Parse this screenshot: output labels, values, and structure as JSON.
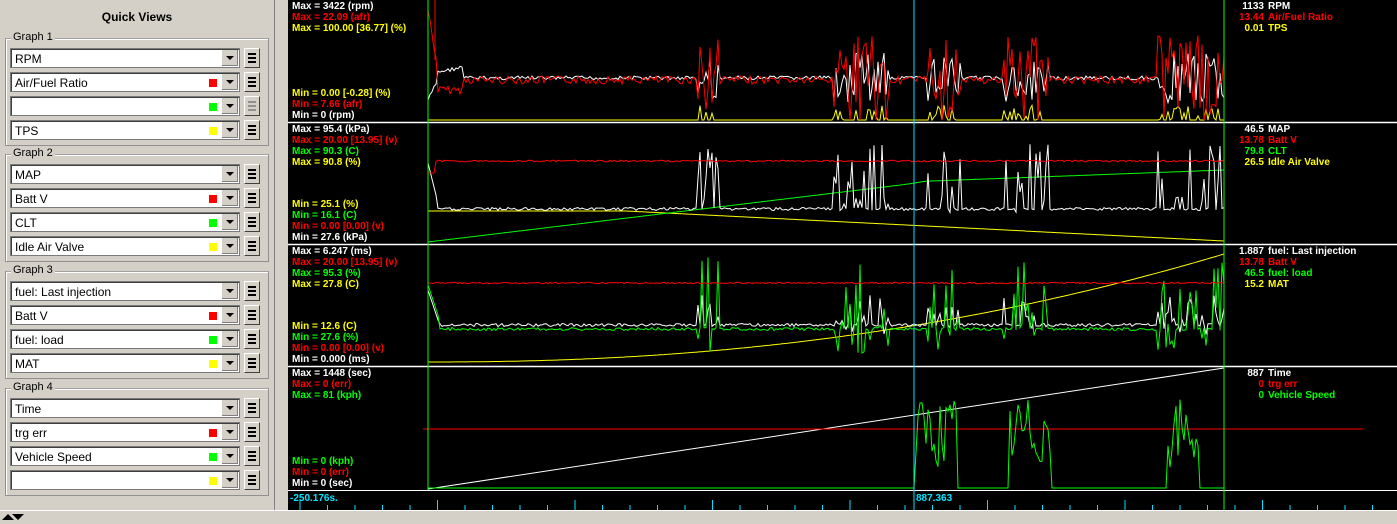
{
  "panel": {
    "title": "Quick Views",
    "groups": [
      {
        "label": "Graph 1",
        "fields": [
          {
            "name": "RPM",
            "color": ""
          },
          {
            "name": "Air/Fuel Ratio",
            "color": "#ff0000"
          },
          {
            "name": "",
            "color": "#00ff00"
          },
          {
            "name": "TPS",
            "color": "#ffff00"
          }
        ]
      },
      {
        "label": "Graph 2",
        "fields": [
          {
            "name": "MAP",
            "color": ""
          },
          {
            "name": "Batt V",
            "color": "#ff0000"
          },
          {
            "name": "CLT",
            "color": "#00ff00"
          },
          {
            "name": "Idle Air Valve",
            "color": "#ffff00"
          }
        ]
      },
      {
        "label": "Graph 3",
        "fields": [
          {
            "name": "fuel: Last injection",
            "color": ""
          },
          {
            "name": "Batt V",
            "color": "#ff0000"
          },
          {
            "name": "fuel: load",
            "color": "#00ff00"
          },
          {
            "name": "MAT",
            "color": "#ffff00"
          }
        ]
      },
      {
        "label": "Graph 4",
        "fields": [
          {
            "name": "Time",
            "color": ""
          },
          {
            "name": "trg err",
            "color": "#ff0000"
          },
          {
            "name": "Vehicle Speed",
            "color": "#00ff00"
          },
          {
            "name": "",
            "color": "#ffff00"
          }
        ]
      }
    ]
  },
  "graphs": [
    {
      "max_labels": [
        {
          "text": "Max = 3422 (rpm)",
          "color": "#ffffff"
        },
        {
          "text": "Max = 22.09 (afr)",
          "color": "#ff0000"
        },
        {
          "text": "Max = 100.00 [36.77] (%)",
          "color": "#ffff00"
        }
      ],
      "min_labels": [
        {
          "text": "Min = 0.00 [-0.28] (%)",
          "color": "#ffff00"
        },
        {
          "text": "Min = 7.66 (afr)",
          "color": "#ff0000"
        },
        {
          "text": "Min = 0 (rpm)",
          "color": "#ffffff"
        }
      ],
      "cursor_values": [
        {
          "value": "1133",
          "name": "RPM",
          "color": "#ffffff"
        },
        {
          "value": "13.44",
          "name": "Air/Fuel Ratio",
          "color": "#ff0000"
        },
        {
          "value": "0.01",
          "name": "TPS",
          "color": "#ffff00"
        }
      ]
    },
    {
      "max_labels": [
        {
          "text": "Max = 95.4 (kPa)",
          "color": "#ffffff"
        },
        {
          "text": "Max = 20.00 [13.95] (v)",
          "color": "#ff0000"
        },
        {
          "text": "Max = 90.3 (C)",
          "color": "#00ff00"
        },
        {
          "text": "Max = 90.8 (%)",
          "color": "#ffff00"
        }
      ],
      "min_labels": [
        {
          "text": "Min = 25.1 (%)",
          "color": "#ffff00"
        },
        {
          "text": "Min = 16.1 (C)",
          "color": "#00ff00"
        },
        {
          "text": "Min = 0.00 [0.00] (v)",
          "color": "#ff0000"
        },
        {
          "text": "Min = 27.6 (kPa)",
          "color": "#ffffff"
        }
      ],
      "cursor_values": [
        {
          "value": "46.5",
          "name": "MAP",
          "color": "#ffffff"
        },
        {
          "value": "13.78",
          "name": "Batt V",
          "color": "#ff0000"
        },
        {
          "value": "79.8",
          "name": "CLT",
          "color": "#00ff00"
        },
        {
          "value": "26.5",
          "name": "Idle Air Valve",
          "color": "#ffff00"
        }
      ]
    },
    {
      "max_labels": [
        {
          "text": "Max = 6.247 (ms)",
          "color": "#ffffff"
        },
        {
          "text": "Max = 20.00 [13.95] (v)",
          "color": "#ff0000"
        },
        {
          "text": "Max = 95.3 (%)",
          "color": "#00ff00"
        },
        {
          "text": "Max = 27.8 (C)",
          "color": "#ffff00"
        }
      ],
      "min_labels": [
        {
          "text": "Min = 12.6 (C)",
          "color": "#ffff00"
        },
        {
          "text": "Min = 27.6 (%)",
          "color": "#00ff00"
        },
        {
          "text": "Min = 0.00 [0.00] (v)",
          "color": "#ff0000"
        },
        {
          "text": "Min = 0.000 (ms)",
          "color": "#ffffff"
        }
      ],
      "cursor_values": [
        {
          "value": "1.887",
          "name": "fuel: Last injection",
          "color": "#ffffff"
        },
        {
          "value": "13.78",
          "name": "Batt V",
          "color": "#ff0000"
        },
        {
          "value": "46.5",
          "name": "fuel: load",
          "color": "#00ff00"
        },
        {
          "value": "15.2",
          "name": "MAT",
          "color": "#ffff00"
        }
      ]
    },
    {
      "max_labels": [
        {
          "text": "Max = 1448 (sec)",
          "color": "#ffffff"
        },
        {
          "text": "Max = 0 (err)",
          "color": "#ff0000"
        },
        {
          "text": "Max = 81 (kph)",
          "color": "#00ff00"
        }
      ],
      "min_labels": [
        {
          "text": "Min = 0 (kph)",
          "color": "#00ff00"
        },
        {
          "text": "Min = 0 (err)",
          "color": "#ff0000"
        },
        {
          "text": "Min = 0 (sec)",
          "color": "#ffffff"
        }
      ],
      "cursor_values": [
        {
          "value": "887",
          "name": "Time",
          "color": "#ffffff"
        },
        {
          "value": "0",
          "name": "trg err",
          "color": "#ff0000"
        },
        {
          "value": "0",
          "name": "Vehicle Speed",
          "color": "#00ff00"
        }
      ]
    }
  ],
  "timeline": {
    "left_time": "-250.176s.",
    "cursor_time": "887.363"
  },
  "colors": {
    "background": "#000000",
    "cursor": "#00ff00",
    "marker": "#00e5ff",
    "divider": "#ffffff"
  }
}
